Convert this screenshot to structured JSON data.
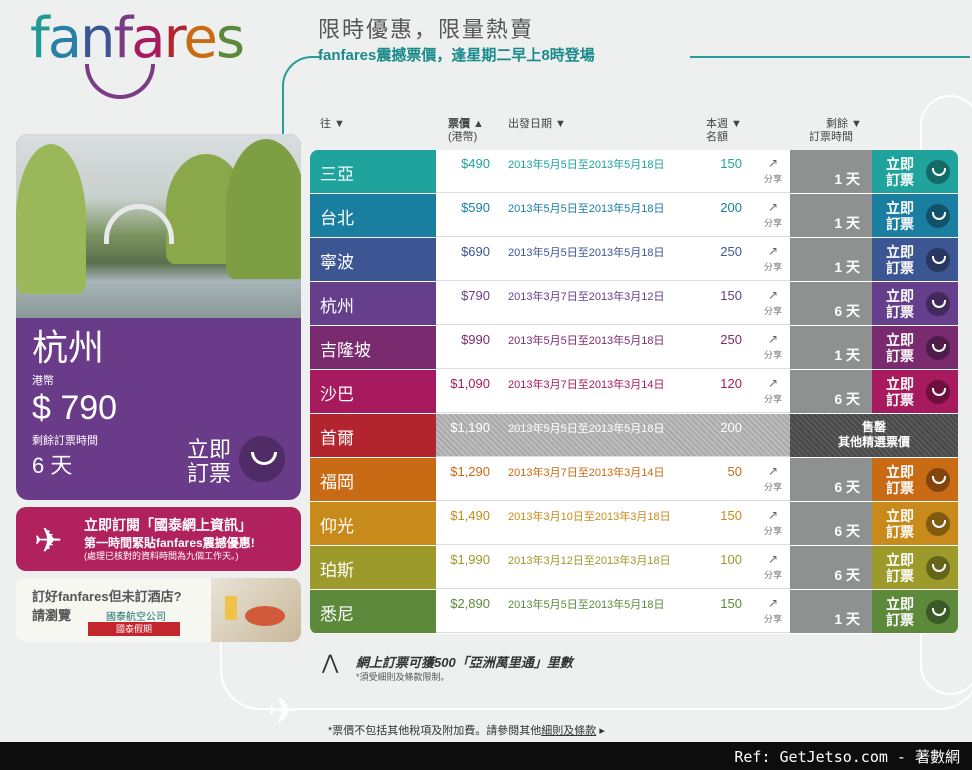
{
  "brand": {
    "logo_text": "fanfares",
    "tagline": "限時優惠，限量熱賣",
    "subtagline": "fanfares震撼票價，逢星期二早上8時登場"
  },
  "featured": {
    "city": "杭州",
    "currency": "港幣",
    "price": "$ 790",
    "remain_label": "剩餘訂票時間",
    "days": "6 天",
    "book_label_1": "立即",
    "book_label_2": "訂票"
  },
  "promo_subscribe": {
    "title": "立即訂閱「國泰網上資訊」",
    "subtitle": "第一時間緊貼fanfares震撼優惠!",
    "note": "(處理已核對的資料時間為九個工作天。)"
  },
  "promo_hotel": {
    "title": "訂好fanfares但未訂酒店?",
    "subtitle": "請瀏覽",
    "logo_text": "國泰航空公司",
    "badge": "國泰假期"
  },
  "table": {
    "headers": {
      "destination": "往 ▼",
      "fare": "票價 ▲",
      "fare_sub": "(港幣)",
      "departure": "出發日期 ▼",
      "quota": "本週 ▼",
      "quota_sub": "名額",
      "remaining": "剩餘 ▼",
      "remaining_sub": "訂票時間"
    },
    "share_label": "分享",
    "book_line1": "立即",
    "book_line2": "訂票",
    "rows": [
      {
        "city": "三亞",
        "price": "$490",
        "dates": "2013年5月5日至2013年5月18日",
        "quota": "150",
        "remain": "1 天",
        "color": "#1fa39c"
      },
      {
        "city": "台北",
        "price": "$590",
        "dates": "2013年5月5日至2013年5月18日",
        "quota": "200",
        "remain": "1 天",
        "color": "#1a7ea1"
      },
      {
        "city": "寧波",
        "price": "$690",
        "dates": "2013年5月5日至2013年5月18日",
        "quota": "250",
        "remain": "1 天",
        "color": "#3c5593"
      },
      {
        "city": "杭州",
        "price": "$790",
        "dates": "2013年3月7日至2013年3月12日",
        "quota": "150",
        "remain": "6 天",
        "color": "#653f8c"
      },
      {
        "city": "吉隆坡",
        "price": "$990",
        "dates": "2013年5月5日至2013年5月18日",
        "quota": "250",
        "remain": "1 天",
        "color": "#7a2a6e"
      },
      {
        "city": "沙巴",
        "price": "$1,090",
        "dates": "2013年3月7日至2013年3月14日",
        "quota": "120",
        "remain": "6 天",
        "color": "#a81a5e"
      },
      {
        "city": "首爾",
        "price": "$1,190",
        "dates": "2013年5月5日至2013年5月18日",
        "quota": "200",
        "remain": "",
        "color": "#b2252e",
        "soldout": true
      },
      {
        "city": "福岡",
        "price": "$1,290",
        "dates": "2013年3月7日至2013年3月14日",
        "quota": "50",
        "remain": "6 天",
        "color": "#c96a15"
      },
      {
        "city": "仰光",
        "price": "$1,490",
        "dates": "2013年3月10日至2013年3月18日",
        "quota": "150",
        "remain": "6 天",
        "color": "#c88a1a"
      },
      {
        "city": "珀斯",
        "price": "$1,990",
        "dates": "2013年3月12日至2013年3月18日",
        "quota": "100",
        "remain": "6 天",
        "color": "#9c9a2a"
      },
      {
        "city": "悉尼",
        "price": "$2,890",
        "dates": "2013年5月5日至2013年5月18日",
        "quota": "150",
        "remain": "1 天",
        "color": "#5c8a3a"
      }
    ],
    "soldout_title": "售罄",
    "soldout_sub": "其他精選票價"
  },
  "miles": {
    "title": "網上訂票可獲500「亞洲萬里通」里數",
    "note": "*須受細則及條款限制。"
  },
  "footnote": {
    "text": "*票價不包括其他稅項及附加費。請參閱其他",
    "link": "細則及條款",
    "arrow": "▸"
  },
  "bottom_bar": {
    "ref": "Ref: GetJetso.com - 著數網"
  }
}
